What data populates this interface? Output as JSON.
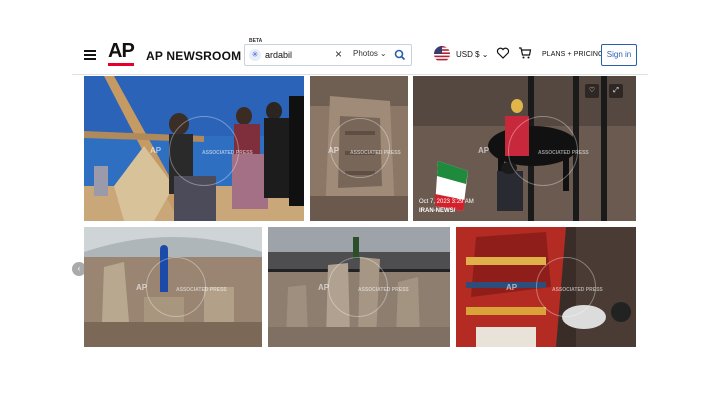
{
  "header": {
    "brand": "AP NEWSROOM",
    "logo_text": "AP",
    "search": {
      "beta_label": "BETA",
      "value": "ardabil",
      "scope": "Photos"
    },
    "currency": "USD $",
    "plans_label": "PLANS + PRICING",
    "signin_label": "Sign in"
  },
  "photos": [
    {
      "alt": "Women in headscarves and floral dresses beside wooden poles under blue sky",
      "watermark": "ASSOCIATED PRESS",
      "ap_mark": "AP"
    },
    {
      "alt": "Carved ancient stone close-up",
      "watermark": "ASSOCIATED PRESS",
      "ap_mark": "AP"
    },
    {
      "alt": "Rider in red on black horse with Iranian flag",
      "watermark": "ASSOCIATED PRESS",
      "ap_mark": "AP",
      "date": "Oct 7, 2023 3:29 AM",
      "source": "IRAN-NEWS/"
    },
    {
      "alt": "Archaeological excavation site under dome with person in blue",
      "watermark": "ASSOCIATED PRESS",
      "ap_mark": "AP"
    },
    {
      "alt": "Ancient standing stones with person on walkway",
      "watermark": "ASSOCIATED PRESS",
      "ap_mark": "AP"
    },
    {
      "alt": "Woman in red patterned clothing painting",
      "watermark": "ASSOCIATED PRESS",
      "ap_mark": "AP"
    }
  ],
  "colors": {
    "ap_red": "#e4002b",
    "signin_blue": "#2a5fb0"
  }
}
